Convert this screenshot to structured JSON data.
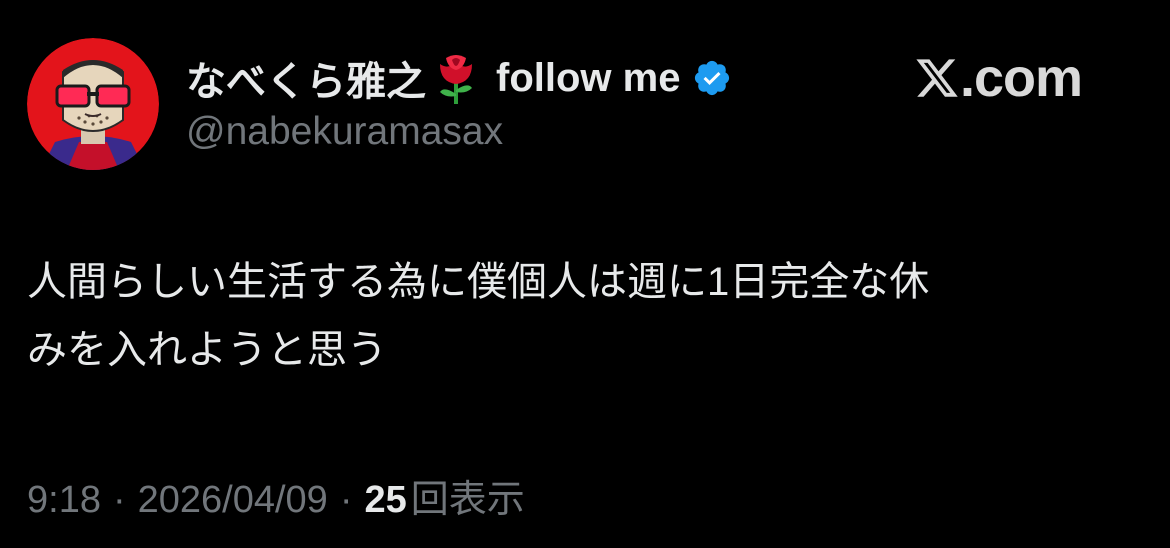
{
  "author": {
    "display_name": "なべくら雅之",
    "name_emoji": "rose-icon",
    "name_suffix": "follow me",
    "verified_icon": "verified-badge-icon",
    "handle": "@nabekuramasax",
    "avatar_icon": "avatar-illustration"
  },
  "brand": {
    "logo_icon": "x-logo-icon",
    "text": ".com"
  },
  "tweet": {
    "lines": [
      "人間らしい生活する為に僕個人は週に1日完全な休",
      "みを入れようと思う"
    ]
  },
  "meta": {
    "time": "9:18",
    "separator": "·",
    "date": "2026/04/09",
    "views_count": "25",
    "views_label": "回表示"
  },
  "colors": {
    "background": "#000000",
    "text_primary": "#e7e9ea",
    "text_secondary": "#71767b",
    "verified_blue": "#1d9bf0",
    "avatar_red": "#e3141b"
  }
}
